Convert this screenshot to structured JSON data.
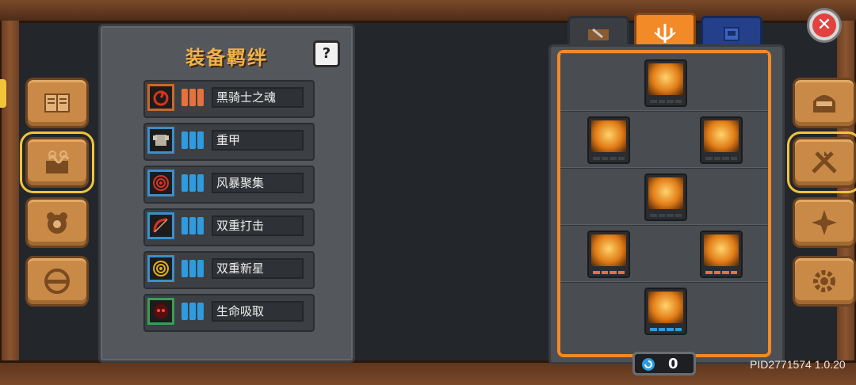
{
  "bonds_panel": {
    "title": "装备羁绊",
    "help_label": "?",
    "bonds": [
      {
        "name": "黑骑士之魂",
        "tier_color": "orange",
        "icon": "dark-swirl-icon"
      },
      {
        "name": "重甲",
        "tier_color": "blue",
        "icon": "armor-icon"
      },
      {
        "name": "风暴聚集",
        "tier_color": "blue",
        "icon": "storm-target-icon"
      },
      {
        "name": "双重打击",
        "tier_color": "blue",
        "icon": "bow-icon"
      },
      {
        "name": "双重新星",
        "tier_color": "blue",
        "icon": "nova-rings-icon"
      },
      {
        "name": "生命吸取",
        "tier_color": "blue",
        "icon": "life-drain-icon"
      }
    ]
  },
  "left_menu": [
    {
      "icon": "book-icon",
      "active": false
    },
    {
      "icon": "swirl-box-icon",
      "active": true
    },
    {
      "icon": "pawprint-icon",
      "active": false
    },
    {
      "icon": "helmet-visor-icon",
      "active": false
    }
  ],
  "right_menu": [
    {
      "icon": "helmet-icon",
      "active": false
    },
    {
      "icon": "crossed-swords-icon",
      "active": true
    },
    {
      "icon": "compass-star-icon",
      "active": false
    },
    {
      "icon": "gear-icon",
      "active": false
    }
  ],
  "tabs": [
    {
      "icon": "tool-icon",
      "active": false
    },
    {
      "icon": "trident-emblem-icon",
      "active": true
    },
    {
      "icon": "blue-scroll-icon",
      "active": false
    }
  ],
  "skill_rows": [
    [
      {
        "icon": "golden-fist-icon",
        "bar": "none"
      }
    ],
    [
      {
        "icon": "crossed-slash-icon",
        "bar": "none"
      },
      {
        "icon": "fireball-icon",
        "bar": "none"
      }
    ],
    [
      {
        "icon": "dice-bread-icon",
        "bar": "none"
      }
    ],
    [
      {
        "icon": "flame-swirl-icon",
        "bar": "orange"
      },
      {
        "icon": "fire-golem-icon",
        "bar": "orange"
      }
    ],
    [
      {
        "icon": "fire-spirit-icon",
        "bar": "blue"
      }
    ]
  ],
  "currency": {
    "icon": "blue-spiral-icon",
    "value": "0"
  },
  "close_label": "✕",
  "version": "PID2771574 1.0.20",
  "colors": {
    "accent": "#f28a28",
    "gold": "#f0b24a",
    "blue": "#2e9be0",
    "orange": "#e8703a"
  }
}
